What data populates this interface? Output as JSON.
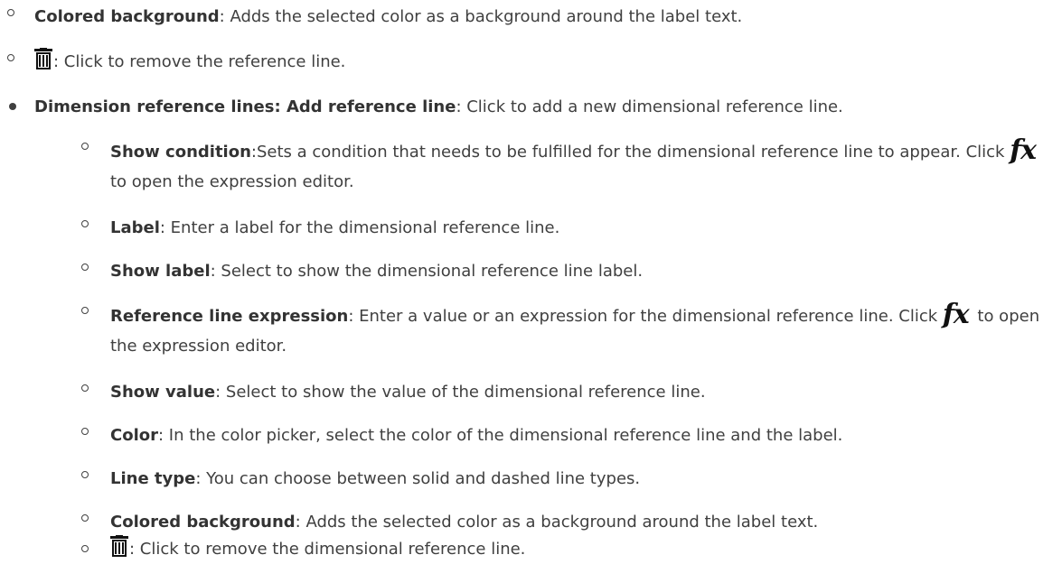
{
  "level2_items_top": [
    {
      "bold": "Colored background",
      "text": ": Adds the selected color as a background around the label text."
    },
    {
      "icon": "trash-icon",
      "text": ": Click to remove the reference line."
    }
  ],
  "dimension": {
    "bold1": "Dimension reference lines",
    "sep": ": ",
    "bold2": "Add reference line",
    "text": ": Click to add a new dimensional reference line."
  },
  "sub": {
    "show_condition": {
      "bold": "Show condition",
      "text1": ":Sets a condition that needs to be fulfilled for the dimensional reference line to appear. Click ",
      "fx": "fx",
      "text2": " to open the expression editor."
    },
    "label": {
      "bold": "Label",
      "text": ": Enter a label for the dimensional reference line."
    },
    "show_label": {
      "bold": "Show label",
      "text": ": Select to show the dimensional reference line label."
    },
    "expression": {
      "bold": "Reference line expression",
      "text1": ": Enter a value or an expression for the dimensional reference line. Click ",
      "fx": "fx",
      "text2": " to open the expression editor."
    },
    "show_value": {
      "bold": "Show value",
      "text": ": Select to show the value of the dimensional reference line."
    },
    "color": {
      "bold": "Color",
      "text": ": In the color picker, select the color of the dimensional reference line and the label."
    },
    "line_type": {
      "bold": "Line type",
      "text": ": You can choose between solid and dashed line types."
    },
    "colored_bg": {
      "bold": "Colored background",
      "text": ": Adds the selected color as a background around the label text."
    },
    "remove": {
      "icon": "trash-icon",
      "text": ": Click to remove the dimensional reference line."
    }
  }
}
